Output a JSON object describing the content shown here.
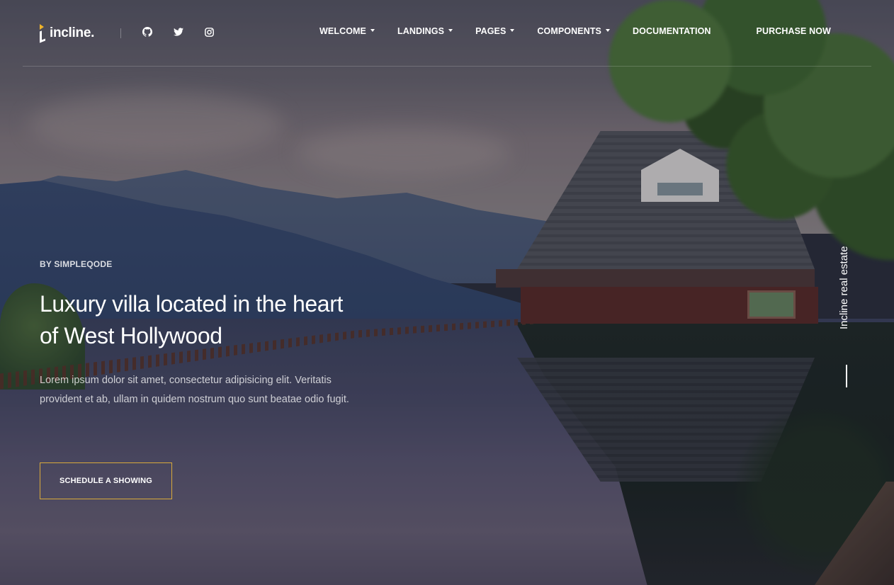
{
  "brand": {
    "name": "incline.",
    "accent_color": "#f0b429"
  },
  "social": [
    {
      "name": "github-icon"
    },
    {
      "name": "twitter-icon"
    },
    {
      "name": "instagram-icon"
    }
  ],
  "nav": {
    "items": [
      {
        "label": "WELCOME",
        "has_dropdown": true
      },
      {
        "label": "LANDINGS",
        "has_dropdown": true
      },
      {
        "label": "PAGES",
        "has_dropdown": true
      },
      {
        "label": "COMPONENTS",
        "has_dropdown": true
      },
      {
        "label": "DOCUMENTATION",
        "has_dropdown": false
      }
    ],
    "purchase_label": "PURCHASE NOW"
  },
  "hero": {
    "eyebrow": "BY SIMPLEQODE",
    "headline": "Luxury villa located in the heart of West Hollywood",
    "description": "Lorem ipsum dolor sit amet, consectetur adipisicing elit. Veritatis provident et ab, ullam in quidem nostrum quo sunt beatae odio fugit.",
    "cta_label": "SCHEDULE A SHOWING",
    "cta_border_color": "#d9a93b",
    "side_label": "Incline real estate"
  }
}
